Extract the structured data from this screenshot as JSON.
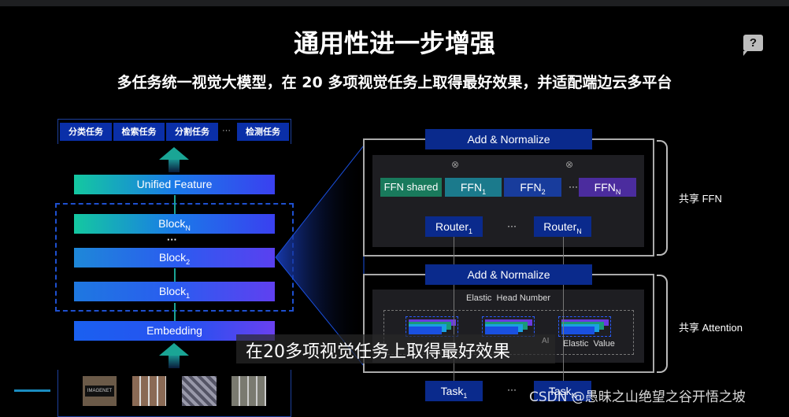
{
  "title": "通用性进一步增强",
  "subtitle": "多任务统一视觉大模型，在 20 多项视觉任务上取得最好效果，并适配端边云多平台",
  "help_icon": "help-speech-bubble-icon",
  "left": {
    "tasks": [
      "分类任务",
      "检索任务",
      "分割任务",
      "···",
      "检测任务"
    ],
    "unified": "Unified Feature",
    "blockN": {
      "base": "Block",
      "sub": "N"
    },
    "dots": "···",
    "block2": {
      "base": "Block",
      "sub": "2"
    },
    "block1": {
      "base": "Block",
      "sub": "1"
    },
    "embedding": "Embedding",
    "dataset_thumb_label": "IMAGENET"
  },
  "right": {
    "add_norm_top": "Add & Normalize",
    "ffn_shared": "FFN shared",
    "ffn1": {
      "base": "FFN",
      "sub": "1"
    },
    "ffn2": {
      "base": "FFN",
      "sub": "2"
    },
    "ffnN": {
      "base": "FFN",
      "sub": "N"
    },
    "dots": "···",
    "router1": {
      "base": "Router",
      "sub": "1"
    },
    "routerN": {
      "base": "Router",
      "sub": "N"
    },
    "shared_ffn": "共享 FFN",
    "add_norm_bottom": "Add & Normalize",
    "elastic_head": "Elastic  Head Number",
    "elastic_value": "Elastic  Value",
    "shared_attention": "共享 Attention",
    "task1": {
      "base": "Task",
      "sub": "1"
    },
    "taskN": {
      "base": "Task",
      "sub": "N"
    }
  },
  "caption": "在20多项视觉任务上取得最好效果",
  "caption_badge": "AI",
  "watermark": "CSDN @愚昧之山绝望之谷开悟之坡",
  "colors": {
    "ffn_shared": "#197a5c",
    "ffn1": "#1b7a8c",
    "ffn2": "#183c9c",
    "ffnN": "#4b2c9e",
    "navy": "#0a2a8c"
  }
}
